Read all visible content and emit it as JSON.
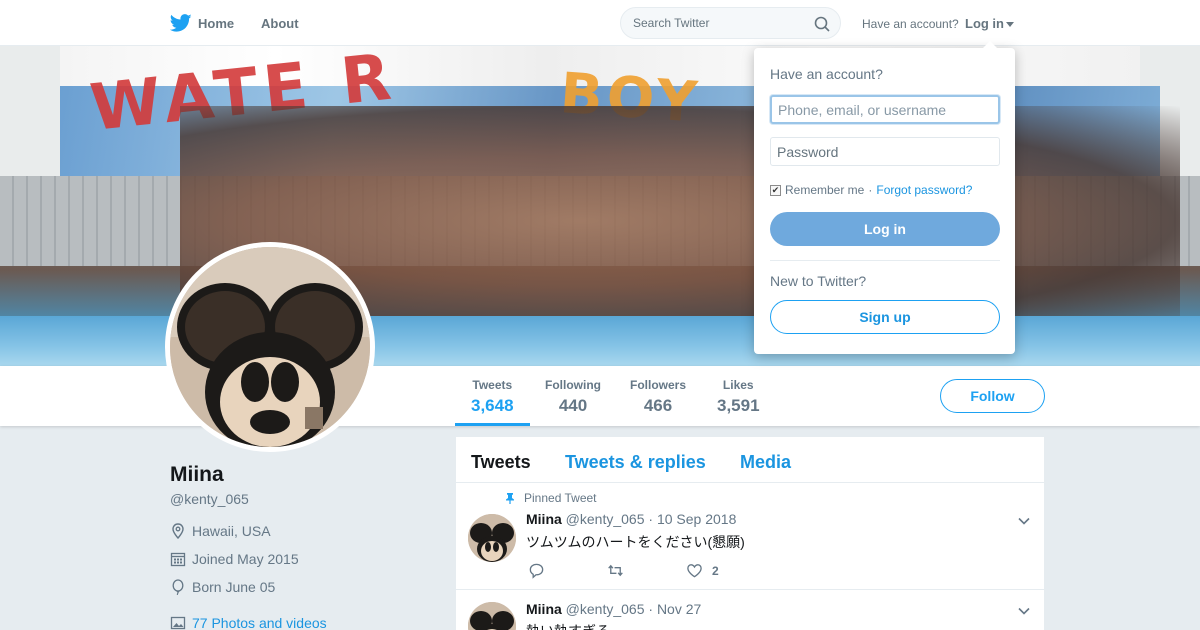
{
  "nav": {
    "home_label": "Home",
    "about_label": "About",
    "search_placeholder": "Search Twitter",
    "have_account": "Have an account?",
    "login_label": "Log in"
  },
  "banner": {
    "mural_text_1": "WATE R",
    "mural_text_2": "BOY"
  },
  "login_dropdown": {
    "title": "Have an account?",
    "username_placeholder": "Phone, email, or username",
    "password_placeholder": "Password",
    "remember_me": "Remember me",
    "separator": "·",
    "forgot_password": "Forgot password?",
    "login_button": "Log in",
    "new_to_twitter": "New to Twitter?",
    "signup_button": "Sign up"
  },
  "stats": [
    {
      "label": "Tweets",
      "value": "3,648",
      "active": true
    },
    {
      "label": "Following",
      "value": "440",
      "active": false
    },
    {
      "label": "Followers",
      "value": "466",
      "active": false
    },
    {
      "label": "Likes",
      "value": "3,591",
      "active": false
    }
  ],
  "follow_button": "Follow",
  "profile": {
    "name": "Miina",
    "handle": "@kenty_065",
    "location": "Hawaii, USA",
    "joined": "Joined May 2015",
    "born": "Born June 05",
    "photos_link": "77 Photos and videos"
  },
  "tabs": [
    {
      "label": "Tweets",
      "active": true
    },
    {
      "label": "Tweets & replies",
      "active": false
    },
    {
      "label": "Media",
      "active": false
    }
  ],
  "tweets": [
    {
      "pinned_label": "Pinned Tweet",
      "name": "Miina",
      "handle": "@kenty_065",
      "date": "· 10 Sep 2018",
      "text": "ツムツムのハートをください(懇願)",
      "likes": "2"
    },
    {
      "name": "Miina",
      "handle": "@kenty_065",
      "date": "· Nov 27",
      "text": "執い執すぎる"
    }
  ],
  "colors": {
    "accent": "#1da1f2",
    "link": "#1b95e0",
    "muted": "#657786",
    "background": "#e6ecf0"
  }
}
